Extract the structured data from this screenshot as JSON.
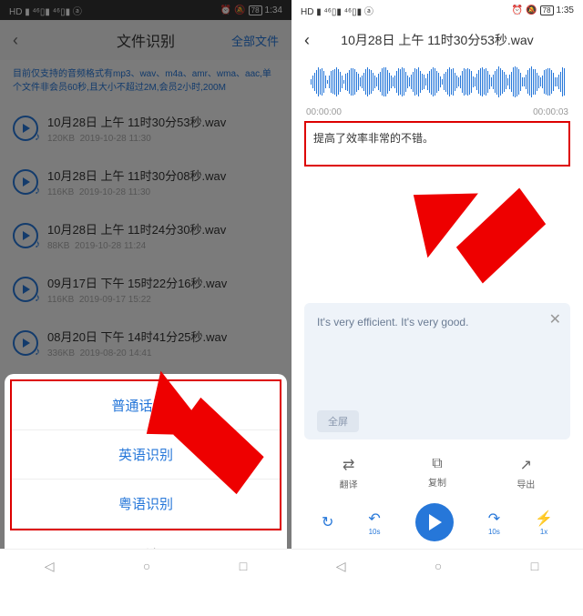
{
  "left": {
    "status": {
      "left": "HD ▮ ⁴⁶▯▮ ⁴⁶▯▮ ⓐ",
      "alarm": "⏰",
      "silent": "🔕",
      "battery": "78",
      "time": "1:34"
    },
    "header": {
      "title": "文件识别",
      "link": "全部文件"
    },
    "subtitle": "目前仅支持的音频格式有mp3、wav、m4a、amr、wma、aac,单个文件非会员60秒,且大小不超过2M,会员2小时,200M",
    "files": [
      {
        "name": "10月28日 上午 11时30分53秒.wav",
        "size": "120KB",
        "date": "2019-10-28 11:30"
      },
      {
        "name": "10月28日 上午 11时30分08秒.wav",
        "size": "116KB",
        "date": "2019-10-28 11:30"
      },
      {
        "name": "10月28日 上午 11时24分30秒.wav",
        "size": "88KB",
        "date": "2019-10-28 11:24"
      },
      {
        "name": "09月17日 下午 15时22分16秒.wav",
        "size": "116KB",
        "date": "2019-09-17 15:22"
      },
      {
        "name": "08月20日 下午 14时41分25秒.wav",
        "size": "336KB",
        "date": "2019-08-20 14:41"
      }
    ],
    "sheet": {
      "opt1": "普通话识别",
      "opt2": "英语识别",
      "opt3": "粤语识别",
      "cancel": "取消"
    }
  },
  "right": {
    "status": {
      "left": "HD ▮ ⁴⁶▯▮ ⁴⁶▯▮ ⓐ",
      "alarm": "⏰",
      "silent": "🔕",
      "battery": "78",
      "time": "1:35"
    },
    "header": {
      "title": "10月28日 上午 11时30分53秒.wav"
    },
    "time": {
      "start": "00:00:00",
      "end": "00:00:03"
    },
    "recognized": "提高了效率非常的不错。",
    "translated": "It's very efficient. It's very good.",
    "full_btn": "全屏",
    "tools": {
      "t1": "翻译",
      "t2": "复制",
      "t3": "导出"
    },
    "play": {
      "back": "10s",
      "fwd": "10s",
      "speed": "1x"
    }
  },
  "nav": {
    "back": "◁",
    "home": "○",
    "recent": "□"
  }
}
